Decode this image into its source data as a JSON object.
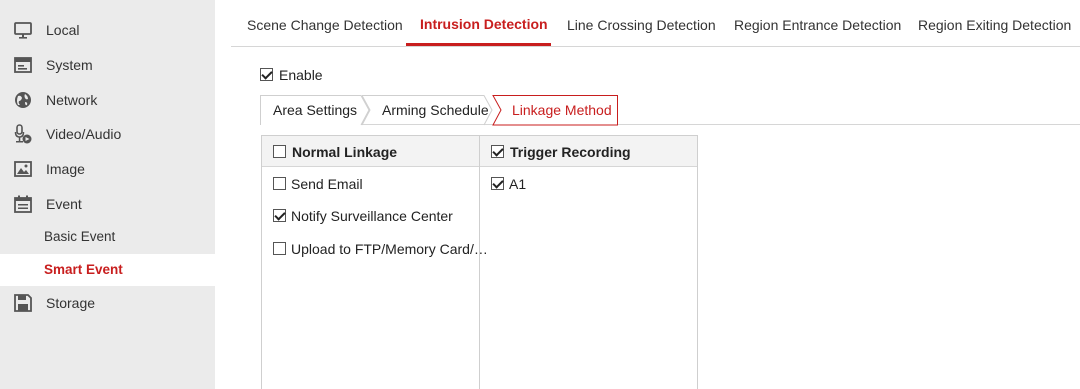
{
  "sidebar": {
    "items": [
      {
        "label": "Local",
        "icon": "monitor-icon"
      },
      {
        "label": "System",
        "icon": "system-window-icon"
      },
      {
        "label": "Network",
        "icon": "globe-icon"
      },
      {
        "label": "Video/Audio",
        "icon": "microphone-camera-icon"
      },
      {
        "label": "Image",
        "icon": "image-icon"
      },
      {
        "label": "Event",
        "icon": "calendar-icon"
      },
      {
        "label": "Storage",
        "icon": "floppy-disk-icon"
      }
    ],
    "sub_items": [
      {
        "label": "Basic Event",
        "active": false
      },
      {
        "label": "Smart Event",
        "active": true
      }
    ]
  },
  "top_tabs": [
    {
      "label": "Scene Change Detection",
      "active": false
    },
    {
      "label": "Intrusion Detection",
      "active": true
    },
    {
      "label": "Line Crossing Detection",
      "active": false
    },
    {
      "label": "Region Entrance Detection",
      "active": false
    },
    {
      "label": "Region Exiting Detection",
      "active": false
    }
  ],
  "enable": {
    "label": "Enable",
    "checked": true
  },
  "sub_tabs": [
    {
      "label": "Area Settings",
      "active": false
    },
    {
      "label": "Arming Schedule",
      "active": false
    },
    {
      "label": "Linkage Method",
      "active": true
    }
  ],
  "linkage": {
    "normal": {
      "header": "Normal Linkage",
      "header_checked": false,
      "options": [
        {
          "label": "Send Email",
          "checked": false
        },
        {
          "label": "Notify Surveillance Center",
          "checked": true
        },
        {
          "label": "Upload to FTP/Memory Card/…",
          "checked": false
        }
      ]
    },
    "trigger": {
      "header": "Trigger Recording",
      "header_checked": true,
      "options": [
        {
          "label": "A1",
          "checked": true
        }
      ]
    }
  },
  "colors": {
    "accent": "#c81e1e",
    "sidebar_bg": "#ebebeb",
    "table_header_bg": "#f3f3f3"
  }
}
